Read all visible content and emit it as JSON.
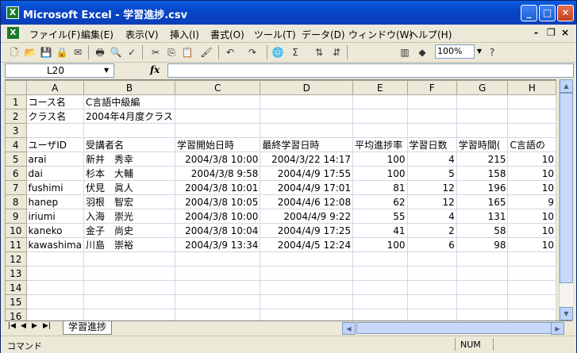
{
  "window": {
    "title": "Microsoft Excel - 学習進捗.csv",
    "app_icon": "X",
    "controls": {
      "minimize": "_",
      "maximize": "□",
      "close": "✕"
    }
  },
  "menubar": {
    "items": [
      "ファイル(F)",
      "編集(E)",
      "表示(V)",
      "挿入(I)",
      "書式(O)",
      "ツール(T)",
      "データ(D)",
      "ウィンドウ(W)",
      "ヘルプ(H)"
    ],
    "doc_controls": {
      "minimize": "-",
      "restore": "❐",
      "close": "×"
    }
  },
  "toolbar": {
    "zoom": "100%",
    "icons": [
      "new-icon",
      "open-icon",
      "save-icon",
      "permission-icon",
      "email-icon",
      "print-icon",
      "print-preview-icon",
      "spelling-icon",
      "cut-icon",
      "copy-icon",
      "paste-icon",
      "format-painter-icon",
      "undo-icon",
      "redo-icon",
      "hyperlink-icon",
      "autosum-icon",
      "sort-asc-icon",
      "sort-desc-icon",
      "chart-wizard-icon",
      "drawing-icon",
      "help-icon"
    ]
  },
  "formula_bar": {
    "name_box": "L20",
    "fx_label": "fx",
    "formula": ""
  },
  "sheet": {
    "columns": [
      "A",
      "B",
      "C",
      "D",
      "E",
      "F",
      "G",
      "H"
    ],
    "rows": [
      {
        "n": "1",
        "cells": [
          "コース名",
          "C言語中級編",
          "",
          "",
          "",
          "",
          "",
          ""
        ]
      },
      {
        "n": "2",
        "cells": [
          "クラス名",
          "2004年4月度クラス",
          "",
          "",
          "",
          "",
          "",
          ""
        ]
      },
      {
        "n": "3",
        "cells": [
          "",
          "",
          "",
          "",
          "",
          "",
          "",
          ""
        ]
      },
      {
        "n": "4",
        "cells": [
          "ユーザID",
          "受講者名",
          "学習開始日時",
          "最終学習日時",
          "平均進捗率",
          "学習日数",
          "学習時間(",
          "C言語の"
        ]
      },
      {
        "n": "5",
        "cells": [
          "arai",
          "新井　秀幸",
          "2004/3/8 10:00",
          "2004/3/22 14:17",
          "100",
          "4",
          "215",
          "10"
        ]
      },
      {
        "n": "6",
        "cells": [
          "dai",
          "杉本　大輔",
          "2004/3/8 9:58",
          "2004/4/9 17:55",
          "100",
          "5",
          "158",
          "10"
        ]
      },
      {
        "n": "7",
        "cells": [
          "fushimi",
          "伏見　眞人",
          "2004/3/8 10:01",
          "2004/4/9 17:01",
          "81",
          "12",
          "196",
          "10"
        ]
      },
      {
        "n": "8",
        "cells": [
          "hanep",
          "羽根　智宏",
          "2004/3/8 10:05",
          "2004/4/6 12:08",
          "62",
          "12",
          "165",
          "9"
        ]
      },
      {
        "n": "9",
        "cells": [
          "iriumi",
          "入海　崇光",
          "2004/3/8 10:00",
          "2004/4/9 9:22",
          "55",
          "4",
          "131",
          "10"
        ]
      },
      {
        "n": "10",
        "cells": [
          "kaneko",
          "金子　尚史",
          "2004/3/8 10:04",
          "2004/4/9 17:25",
          "41",
          "2",
          "58",
          "10"
        ]
      },
      {
        "n": "11",
        "cells": [
          "kawashima",
          "川島　崇裕",
          "2004/3/9 13:34",
          "2004/4/5 12:24",
          "100",
          "6",
          "98",
          "10"
        ]
      },
      {
        "n": "12",
        "cells": [
          "",
          "",
          "",
          "",
          "",
          "",
          "",
          ""
        ]
      },
      {
        "n": "13",
        "cells": [
          "",
          "",
          "",
          "",
          "",
          "",
          "",
          ""
        ]
      },
      {
        "n": "14",
        "cells": [
          "",
          "",
          "",
          "",
          "",
          "",
          "",
          ""
        ]
      },
      {
        "n": "15",
        "cells": [
          "",
          "",
          "",
          "",
          "",
          "",
          "",
          ""
        ]
      },
      {
        "n": "16",
        "cells": [
          "",
          "",
          "",
          "",
          "",
          "",
          "",
          ""
        ]
      }
    ]
  },
  "sheet_tabs": {
    "active": "学習進捗"
  },
  "status": {
    "mode": "コマンド",
    "numlock": "NUM"
  }
}
